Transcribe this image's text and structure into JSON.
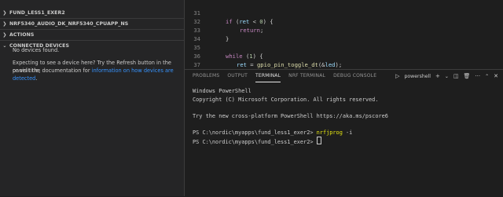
{
  "sidebar": {
    "sections": [
      {
        "title": "FUND_LESS1_EXER2",
        "expanded": false
      },
      {
        "title": "NRF5340_AUDIO_DK_NRF5340_CPUAPP_NS",
        "expanded": false
      },
      {
        "title": "ACTIONS",
        "expanded": false
      },
      {
        "title": "CONNECTED DEVICES",
        "expanded": true
      }
    ],
    "no_devices": "No devices found.",
    "help_line1": "Expecting to see a device here? Try the Refresh button in the panel title,",
    "help_line2_prefix": "or visit the documentation for",
    "help_link": "information on how devices are detected",
    "help_line2_suffix": "."
  },
  "editor": {
    "lines": [
      {
        "num": "31",
        "code": "if (ret < 0) {"
      },
      {
        "num": "32",
        "code": "return;"
      },
      {
        "num": "33",
        "code": "}"
      },
      {
        "num": "34",
        "code": ""
      },
      {
        "num": "35",
        "code": "while (1) {"
      },
      {
        "num": "36",
        "code": "ret = gpio_pin_toggle_dt(&led);"
      },
      {
        "num": "37",
        "code": "if (ret < 0) {"
      },
      {
        "num": "38",
        "code": "return;"
      },
      {
        "num": "39",
        "code": "}"
      }
    ]
  },
  "panel": {
    "tabs": [
      "PROBLEMS",
      "OUTPUT",
      "TERMINAL",
      "NRF TERMINAL",
      "DEBUG CONSOLE"
    ],
    "active_tab": "TERMINAL",
    "shell_name": "powershell",
    "terminal_lines": [
      "Windows PowerShell",
      "Copyright (C) Microsoft Corporation. All rights reserved.",
      "",
      "Try the new cross-platform PowerShell https://aka.ms/pscore6",
      ""
    ],
    "prompt1": "PS C:\\nordic\\myapps\\fund_less1_exer2> ",
    "command": "nrfjprog",
    "command_arg": " -i",
    "prompt2": "PS C:\\nordic\\myapps\\fund_less1_exer2> "
  }
}
